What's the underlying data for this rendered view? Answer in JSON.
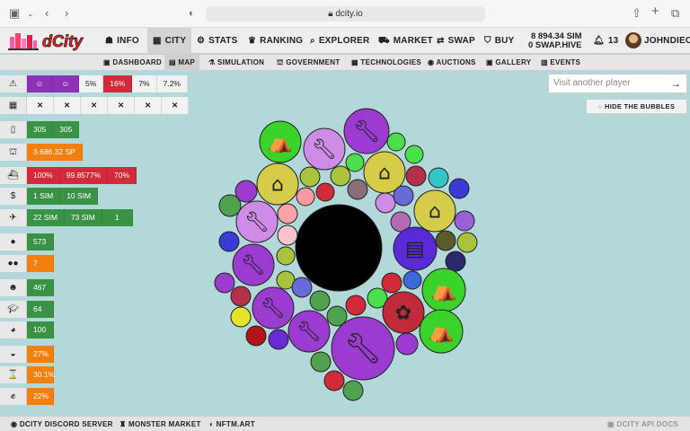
{
  "browser": {
    "url": "dcity.io"
  },
  "nav": {
    "items": [
      {
        "icon": "☗",
        "label": "INFO"
      },
      {
        "icon": "▦",
        "label": "CITY"
      },
      {
        "icon": "⚙",
        "label": "STATS"
      },
      {
        "icon": "♛",
        "label": "RANKING"
      },
      {
        "icon": "⌕",
        "label": "EXPLORER"
      },
      {
        "icon": "⛟",
        "label": "MARKET"
      },
      {
        "icon": "⇄",
        "label": "SWAP"
      },
      {
        "icon": "⛉",
        "label": "BUY"
      }
    ],
    "balance_sim": "8 894.34 SIM",
    "balance_swap": "0 SWAP.HIVE",
    "notifications": "13",
    "username": "JOHNDIEO",
    "logo": "dCity"
  },
  "subnav": [
    "DASHBOARD",
    "MAP",
    "SIMULATION",
    "GOVERNMENT",
    "TECHNOLOGIES",
    "AUCTIONS",
    "GALLERY",
    "EVENTS"
  ],
  "stats": {
    "r1": [
      "☺",
      "☺",
      "5%",
      "16%",
      "7%",
      "7.2%"
    ],
    "r2": [
      "✕",
      "✕",
      "✕",
      "✕",
      "✕",
      "✕"
    ],
    "r3": [
      "305",
      "305"
    ],
    "r4": [
      "3 686.32 SP"
    ],
    "r5": [
      "100%",
      "99.8577%",
      "70%"
    ],
    "r6": [
      "1 SIM",
      "10 SIM"
    ],
    "r7": [
      "22 SIM",
      "73 SIM",
      "1"
    ],
    "r8": [
      "573"
    ],
    "r9": [
      "7"
    ],
    "r10": [
      "467"
    ],
    "r11": [
      "64"
    ],
    "r12": [
      "100"
    ],
    "r13": [
      "27%"
    ],
    "r14": [
      "30.1%"
    ],
    "r15": [
      "22%"
    ]
  },
  "search": {
    "placeholder": "Visit another player"
  },
  "hide_button": "HIDE THE BUBBLES",
  "footer": [
    "DCITY DISCORD SERVER",
    "MONSTER MARKET",
    "NFTM.ART",
    "DCITY API DOCS"
  ],
  "colors": {
    "green": "#3a9344",
    "orange": "#f2800e",
    "red": "#d22a3a",
    "purple": "#8d32b5"
  }
}
